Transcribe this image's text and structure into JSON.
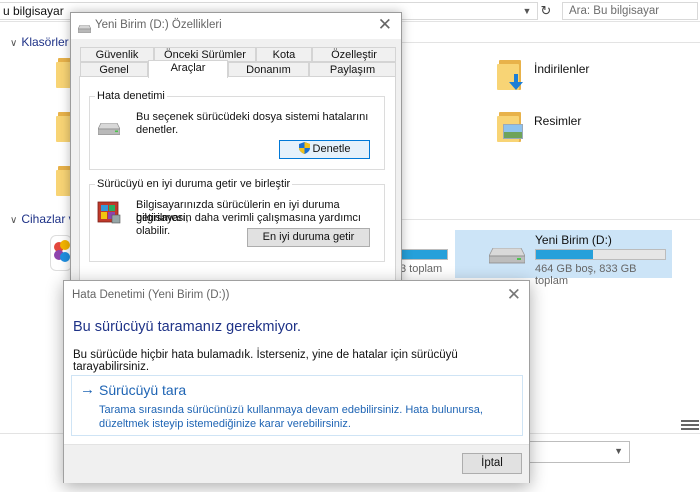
{
  "explorer": {
    "address": "u bilgisayar",
    "search_placeholder": "Ara: Bu bilgisayar",
    "groups": {
      "folders": "Klasörler (",
      "devices": "Cihazlar ve"
    },
    "folders": [
      {
        "label": "İndirilenler",
        "icon": "downloads-folder-icon"
      },
      {
        "label": "Resimler",
        "icon": "pictures-folder-icon"
      }
    ],
    "drive": {
      "name": "Yeni Birim (D:)",
      "free_text": "464 GB boş, 833 GB toplam",
      "used_fraction": 0.44
    },
    "left_drive_total": "3 toplam"
  },
  "props": {
    "title": "Yeni Birim (D:) Özellikleri",
    "close": "✕",
    "tabs_row1": [
      "Güvenlik",
      "Önceki Sürümler",
      "Kota",
      "Özelleştir"
    ],
    "tabs_row2": [
      "Genel",
      "Araçlar",
      "Donanım",
      "Paylaşım"
    ],
    "active_tab": "Araçlar",
    "error_check": {
      "legend": "Hata denetimi",
      "text_line1": "Bu seçenek sürücüdeki dosya sistemi hatalarını",
      "text_line2": "denetler.",
      "button": "Denetle"
    },
    "optimize": {
      "legend": "Sürücüyü en iyi duruma getir ve birleştir",
      "text_line1": "Bilgisayarınızda sürücülerin en iyi duruma getirilmesi,",
      "text_line2": "bilgisayarın daha verimli çalışmasına yardımcı olabilir.",
      "button": "En iyi duruma getir"
    }
  },
  "check": {
    "title": "Hata Denetimi (Yeni Birim (D:))",
    "close": "✕",
    "heading": "Bu sürücüyü taramanız gerekmiyor.",
    "message": "Bu sürücüde hiçbir hata bulamadık. İsterseniz, yine de hatalar için sürücüyü tarayabilirsiniz.",
    "scan": {
      "arrow": "→",
      "title": "Sürücüyü tara",
      "desc": "Tarama sırasında sürücünüzü kullanmaya devam edebilirsiniz. Hata bulunursa, düzeltmek isteyip istemediğinize karar verebilirsiniz."
    },
    "cancel": "İptal"
  }
}
